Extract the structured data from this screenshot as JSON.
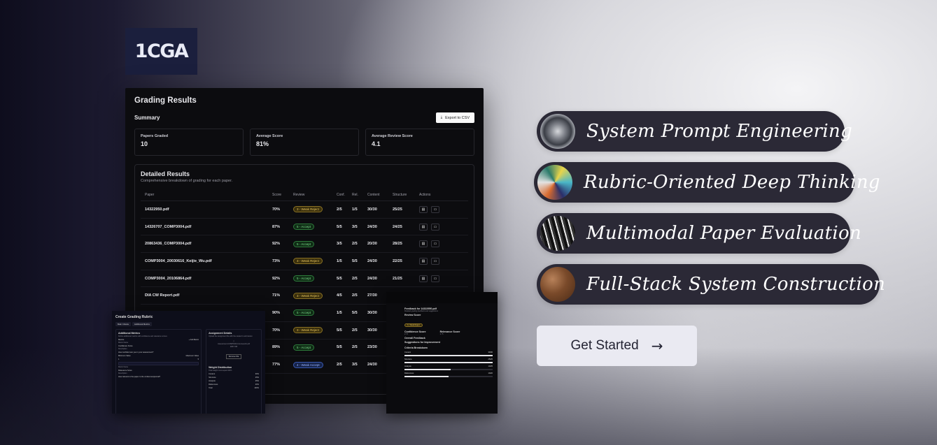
{
  "logo": {
    "text": "1CGA"
  },
  "results": {
    "title": "Grading Results",
    "summary_label": "Summary",
    "export_label": "Export to CSV",
    "stats": [
      {
        "label": "Papers Graded",
        "value": "10"
      },
      {
        "label": "Average Score",
        "value": "81%"
      },
      {
        "label": "Average Review Score",
        "value": "4.1"
      }
    ],
    "detailed_title": "Detailed Results",
    "detailed_subtitle": "Comprehensive breakdown of grading for each paper.",
    "columns": [
      "Paper",
      "Score",
      "Review",
      "Conf.",
      "Rel.",
      "Content",
      "Structure",
      "Actions"
    ],
    "rows": [
      {
        "paper": "14322950.pdf",
        "score": "70%",
        "review": "3 - Weak Reject",
        "kind": "weak",
        "conf": "2/5",
        "rel": "1/5",
        "content": "30/30",
        "structure": "25/25"
      },
      {
        "paper": "14326707_COMP3004.pdf",
        "score": "87%",
        "review": "5 - Accept",
        "kind": "accept",
        "conf": "5/5",
        "rel": "3/5",
        "content": "24/30",
        "structure": "24/25"
      },
      {
        "paper": "20863436_COMP3004.pdf",
        "score": "92%",
        "review": "5 - Accept",
        "kind": "accept",
        "conf": "3/5",
        "rel": "2/5",
        "content": "20/30",
        "structure": "28/25"
      },
      {
        "paper": "COMP3004_20030616_Keijie_Wu.pdf",
        "score": "73%",
        "review": "3 - Weak Reject",
        "kind": "weak",
        "conf": "1/5",
        "rel": "5/5",
        "content": "24/30",
        "structure": "22/25"
      },
      {
        "paper": "COMP3004_20106864.pdf",
        "score": "92%",
        "review": "5 - Accept",
        "kind": "accept",
        "conf": "5/5",
        "rel": "2/5",
        "content": "24/30",
        "structure": "21/25"
      },
      {
        "paper": "DIA CW Report.pdf",
        "score": "71%",
        "review": "3 - Weak Reject",
        "kind": "weak",
        "conf": "4/5",
        "rel": "2/5",
        "content": "27/30",
        "structure": ""
      },
      {
        "paper": "",
        "score": "90%",
        "review": "5 - Accept",
        "kind": "accept",
        "conf": "1/5",
        "rel": "5/5",
        "content": "30/30",
        "structure": ""
      },
      {
        "paper": "",
        "score": "70%",
        "review": "3 - Weak Reject",
        "kind": "weak",
        "conf": "5/5",
        "rel": "2/5",
        "content": "30/30",
        "structure": ""
      },
      {
        "paper": "",
        "score": "89%",
        "review": "5 - Accept",
        "kind": "accept",
        "conf": "5/5",
        "rel": "2/5",
        "content": "23/30",
        "structure": ""
      },
      {
        "paper": "",
        "score": "77%",
        "review": "4 - Weak Accept",
        "kind": "blue",
        "conf": "2/5",
        "rel": "3/5",
        "content": "24/30",
        "structure": ""
      }
    ]
  },
  "rubric": {
    "title": "Create Grading Rubric",
    "tabs": [
      "Main Criteria",
      "Additional Metrics"
    ],
    "section_title": "Additional Metrics",
    "section_sub": "Define additional metrics with confidence and relevance scores",
    "metrics_label": "Metrics",
    "add_metric": "+ Add Metric",
    "metric_name_label": "Metric Name",
    "metric_1_name": "Confidence Score",
    "description_label": "Description",
    "metric_1_desc": "How confident are you in your assessment?",
    "min_label": "Minimum Value",
    "max_label": "Maximum Value",
    "metric_1_min": "1",
    "metric_1_max": "5",
    "metric_2_name": "Relevance Score",
    "metric_2_desc": "How relevant is the paper to the conference/journal?",
    "assignment_title": "Assignment Details",
    "assignment_sub": "Upload the assignment file with the student's submission",
    "file_name": "Assessment-COMP3004-Coursework.pdf",
    "file_size": "298.5 KB",
    "remove_file": "Remove File",
    "weight_title": "Weight Distribution",
    "weight_sub": "Total weight must equal 100%",
    "weights": [
      {
        "name": "Content",
        "value": "30%"
      },
      {
        "name": "Structure",
        "value": "25%"
      },
      {
        "name": "Analysis",
        "value": "25%"
      },
      {
        "name": "References",
        "value": "20%"
      },
      {
        "name": "Total",
        "value": "100%"
      }
    ]
  },
  "feedback": {
    "title": "Feedback for 14322950.pdf",
    "subtitle": "Detailed grading feedback and suggestions",
    "review_score_label": "Review Score",
    "review_badge": "3 - Weak Reject",
    "confidence_label": "Confidence Score",
    "confidence_value": "2 / 5",
    "relevance_label": "Relevance Score",
    "relevance_value": "1 / 5",
    "overall_label": "Overall Feedback",
    "suggestions_label": "Suggestions for Improvement",
    "criteria_label": "Criteria Breakdown",
    "criteria": [
      {
        "name": "Content",
        "value": "30/30",
        "fill": 1.0
      },
      {
        "name": "Structure",
        "value": "25/25",
        "fill": 1.0
      },
      {
        "name": "Analysis",
        "value": "13/25",
        "fill": 0.52
      },
      {
        "name": "References",
        "value": "10/20",
        "fill": 0.5
      }
    ]
  },
  "features": [
    {
      "label": "System Prompt Engineering",
      "icon": "sculpture-image"
    },
    {
      "label": "Rubric-Oriented Deep Thinking",
      "icon": "iridescent-image"
    },
    {
      "label": "Multimodal Paper Evaluation",
      "icon": "pattern-image"
    },
    {
      "label": "Full-Stack System Construction",
      "icon": "wood-sphere-image"
    }
  ],
  "cta": {
    "label": "Get Started",
    "arrow": "→"
  },
  "colors": {
    "pill_bg": "#2b2936",
    "cta_bg": "#eaeaf2",
    "logo_bg": "#1b1f3d",
    "weak_badge": "#e4c25d",
    "accept_badge": "#7dde8c",
    "weak_accept_badge": "#9bb4ff"
  }
}
